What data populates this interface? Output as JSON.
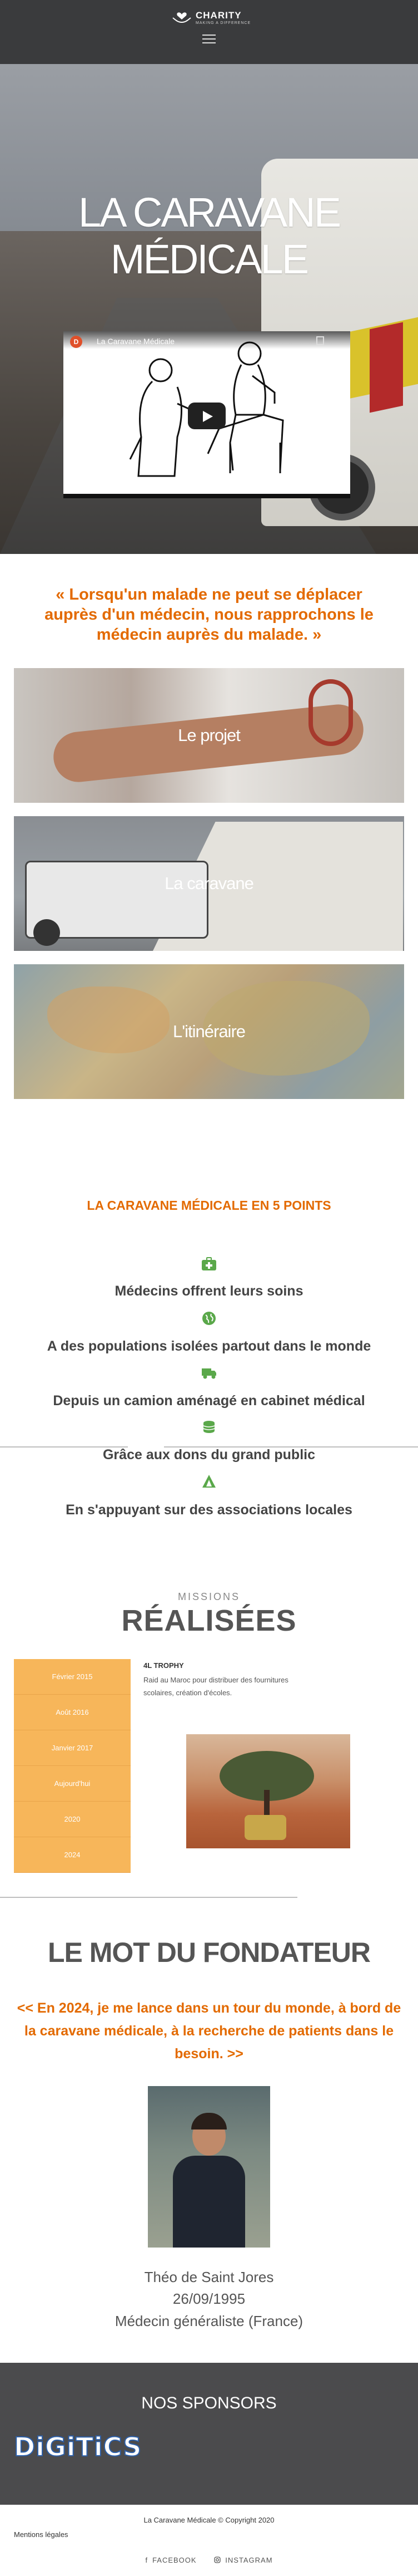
{
  "header": {
    "logo_text": "CHARITY",
    "logo_sub": "MAKING A DIFFERENCE"
  },
  "hero": {
    "title_line1": "LA CARAVANE",
    "title_line2": "MÉDICALE",
    "video": {
      "channel_initial": "D",
      "title": "La Caravane Médicale"
    }
  },
  "quote": "« Lorsqu'un malade ne peut se déplacer auprès d'un médecin, nous rapprochons le médecin auprès du malade. »",
  "tiles": [
    {
      "label": "Le projet"
    },
    {
      "label": "La caravane"
    },
    {
      "label": "L'itinéraire"
    }
  ],
  "points_section": {
    "title": "LA CARAVANE MÉDICALE EN 5 POINTS",
    "items": [
      {
        "icon": "medical-kit-icon",
        "text": "Médecins offrent leurs soins"
      },
      {
        "icon": "globe-icon",
        "text": "A des populations isolées partout dans le monde"
      },
      {
        "icon": "truck-icon",
        "text": "Depuis un camion aménagé en cabinet médical"
      },
      {
        "icon": "coins-icon",
        "text": "Grâce aux dons du grand public"
      },
      {
        "icon": "campfire-icon",
        "text": "En s'appuyant sur des associations locales"
      }
    ]
  },
  "missions": {
    "subtitle": "MISSIONS",
    "title": "RÉALISÉES",
    "timeline": [
      "Février 2015",
      "Août 2016",
      "Janvier 2017",
      "Aujourd'hui",
      "2020",
      "2024"
    ],
    "active": {
      "title": "4L TROPHY",
      "description": "Raid au Maroc pour distribuer des fournitures scolaires, création d'écoles."
    }
  },
  "founder": {
    "title": "LE MOT DU FONDATEUR",
    "quote": "<< En 2024, je me lance dans un tour du monde, à bord de la caravane médicale, à la recherche de patients dans le besoin. >>",
    "name": "Théo de Saint Jores",
    "birthdate": "26/09/1995",
    "role": "Médecin généraliste (France)"
  },
  "sponsors": {
    "title": "NOS SPONSORS",
    "logo_text": "DiGiTiCS"
  },
  "footer": {
    "copyright": "La Caravane Médicale © Copyright 2020",
    "mentions": "Mentions légales",
    "social": [
      {
        "icon": "facebook-icon",
        "label": "FACEBOOK"
      },
      {
        "icon": "instagram-icon",
        "label": "INSTAGRAM"
      }
    ]
  },
  "colors": {
    "accent": "#e36a00",
    "header_bg": "#3a3b3d",
    "timeline_bg": "#f7b65a",
    "icon_green": "#5aa84a",
    "sponsors_bg": "#4b4b4d"
  }
}
